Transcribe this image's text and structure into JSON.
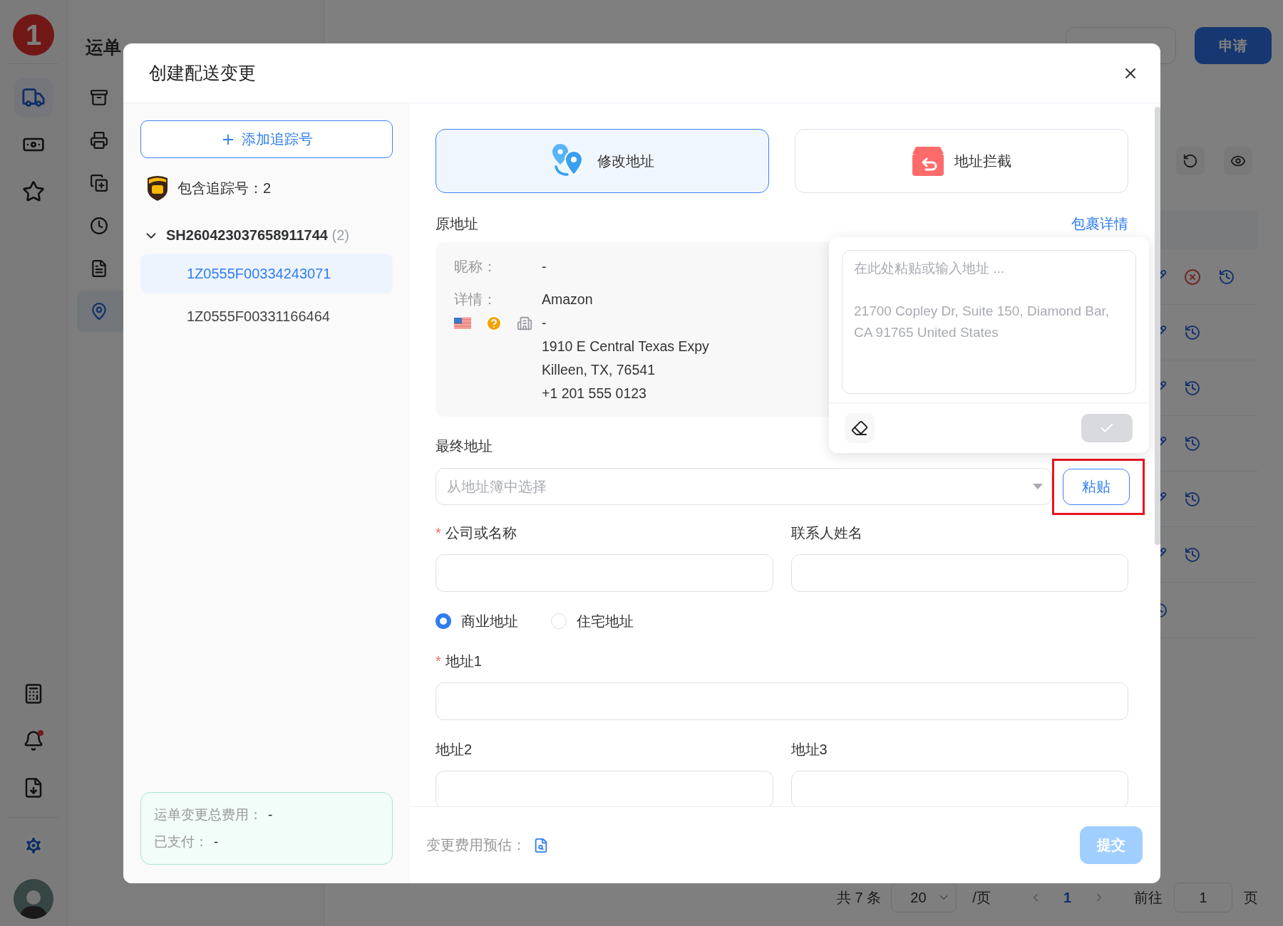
{
  "rail": {
    "logo": "1",
    "items": [
      {
        "kind": "truck",
        "selected": true,
        "dot": false
      },
      {
        "kind": "billing",
        "selected": false,
        "dot": false
      },
      {
        "kind": "star",
        "selected": false,
        "dot": false
      }
    ],
    "bottom_items": [
      {
        "kind": "calculator",
        "dot": false
      },
      {
        "kind": "bell",
        "dot": true
      },
      {
        "kind": "download",
        "dot": false
      },
      {
        "kind": "settings",
        "dot": false
      }
    ]
  },
  "sidenav": {
    "title": "运单",
    "items": [
      {
        "kind": "box",
        "selected": false
      },
      {
        "kind": "printer",
        "selected": false
      },
      {
        "kind": "copy",
        "selected": false
      },
      {
        "kind": "clock",
        "selected": false
      },
      {
        "kind": "file",
        "selected": false
      },
      {
        "kind": "pin",
        "selected": true
      }
    ]
  },
  "topbar": {
    "apply_button": "申请"
  },
  "table": {
    "rows": [
      {
        "actions": [
          {
            "kind": "edit"
          },
          {
            "kind": "cancel"
          },
          {
            "kind": "history"
          }
        ]
      },
      {
        "actions": [
          {
            "kind": "edit"
          },
          {
            "kind": "history"
          }
        ]
      },
      {
        "actions": [
          {
            "kind": "edit"
          },
          {
            "kind": "history"
          }
        ]
      },
      {
        "actions": [
          {
            "kind": "edit"
          },
          {
            "kind": "history"
          }
        ]
      },
      {
        "actions": [
          {
            "kind": "edit"
          },
          {
            "kind": "history"
          }
        ]
      },
      {
        "actions": [
          {
            "kind": "edit"
          },
          {
            "kind": "history"
          }
        ]
      },
      {
        "actions": [
          {
            "kind": "history"
          }
        ]
      }
    ]
  },
  "pagination": {
    "total": "共 7 条",
    "page_size": "20",
    "per_page": "/页",
    "current": "1",
    "goto": "前往",
    "goto_value": "1",
    "page_unit": "页"
  },
  "dialog": {
    "title": "创建配送变更",
    "add_tracking": "添加追踪号",
    "carrier_summary": {
      "label": "包含追踪号：",
      "count": "2"
    },
    "shipments": [
      {
        "id": "SH260423037658911744",
        "count": "(2)",
        "expanded": true,
        "children": [
          {
            "label": "1Z0555F00334243071",
            "selected": true
          },
          {
            "label": "1Z0555F00331166464",
            "selected": false
          }
        ]
      }
    ],
    "cost": {
      "total_label": "运单变更总费用：",
      "total": "-",
      "paid_label": "已支付：",
      "paid": "-"
    },
    "modes": [
      {
        "kind": "modify",
        "label": "修改地址",
        "selected": true
      },
      {
        "kind": "intercept",
        "label": "地址拦截",
        "selected": false
      }
    ],
    "original": {
      "title": "原地址",
      "link": "包裹详情",
      "nickname_label": "昵称：",
      "nickname": "-",
      "detail_label": "详情：",
      "lines": [
        "Amazon",
        "-",
        "1910 E Central Texas Expy",
        "Killeen, TX, 76541",
        "+1 201 555 0123"
      ]
    },
    "paste_popover": {
      "placeholder": "在此处粘贴或输入地址 ...\n\n21700 Copley Dr, Suite 150, Diamond Bar, CA 91765 United States",
      "confirm_disabled": true
    },
    "final": {
      "title": "最终地址",
      "placeholder": "从地址簿中选择",
      "paste": "粘贴",
      "highlighted": true
    },
    "name_row": [
      {
        "label": "公司或名称",
        "required_mark": "*"
      },
      {
        "label": "联系人姓名"
      }
    ],
    "address_type": [
      {
        "label": "商业地址",
        "selected": true
      },
      {
        "label": "住宅地址",
        "selected": false
      }
    ],
    "address1": {
      "label": "地址1",
      "required_mark": "*"
    },
    "address_row": [
      {
        "label": "地址2"
      },
      {
        "label": "地址3"
      }
    ],
    "footer": {
      "estimate_label": "变更费用预估：",
      "submit": "提交",
      "submit_disabled": true
    }
  }
}
